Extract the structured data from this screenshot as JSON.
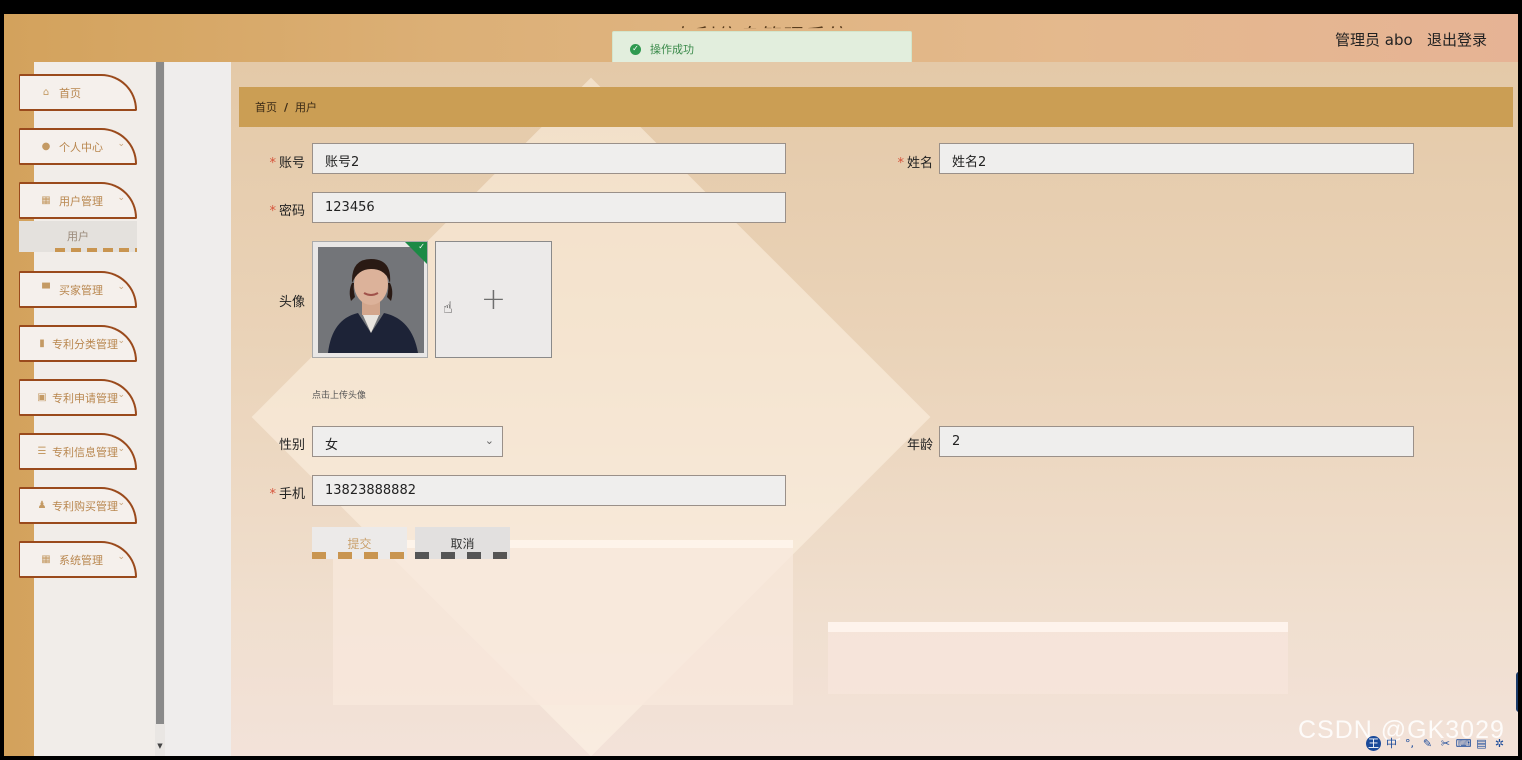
{
  "header": {
    "title": "专利信息管理系统",
    "user_label": "管理员 abo",
    "logout_label": "退出登录"
  },
  "toast": {
    "icon": "check-circle-icon",
    "message": "操作成功",
    "color": "#2f9a50"
  },
  "sidebar": {
    "items": [
      {
        "label": "首页",
        "icon": "home-icon",
        "glyph": "⌂",
        "has_chevron": false
      },
      {
        "label": "个人中心",
        "icon": "user-icon",
        "glyph": "●",
        "has_chevron": true
      },
      {
        "label": "用户管理",
        "icon": "grid-icon",
        "glyph": "▦",
        "has_chevron": true
      },
      {
        "label": "买家管理",
        "icon": "flag-icon",
        "glyph": "▀",
        "has_chevron": true
      },
      {
        "label": "专利分类管理",
        "icon": "chart-icon",
        "glyph": "▮",
        "has_chevron": true
      },
      {
        "label": "专利申请管理",
        "icon": "clipboard-icon",
        "glyph": "▣",
        "has_chevron": true
      },
      {
        "label": "专利信息管理",
        "icon": "sliders-icon",
        "glyph": "☰",
        "has_chevron": true
      },
      {
        "label": "专利购买管理",
        "icon": "person-icon",
        "glyph": "♟",
        "has_chevron": true
      },
      {
        "label": "系统管理",
        "icon": "grid-icon",
        "glyph": "▦",
        "has_chevron": true
      }
    ],
    "submenu_label": "用户",
    "chevron_glyph": "⌄"
  },
  "breadcrumb": {
    "home": "首页",
    "separator": "/",
    "current": "用户"
  },
  "form": {
    "account": {
      "label": "账号",
      "value": "账号2",
      "required": "*"
    },
    "name": {
      "label": "姓名",
      "value": "姓名2",
      "required": "*"
    },
    "password": {
      "label": "密码",
      "value": "123456",
      "required": "*"
    },
    "avatar": {
      "label": "头像",
      "upload_hint": "点击上传头像",
      "upload_glyph": "+"
    },
    "gender": {
      "label": "性别",
      "value": "女"
    },
    "age": {
      "label": "年龄",
      "value": "2"
    },
    "phone": {
      "label": "手机",
      "value": "13823888882",
      "required": "*"
    },
    "submit_label": "提交",
    "cancel_label": "取消"
  },
  "watermark": "CSDN @GK3029",
  "colors": {
    "accent": "#cb9e54",
    "menu_border": "#9a4a1c",
    "required": "#d6533a"
  }
}
